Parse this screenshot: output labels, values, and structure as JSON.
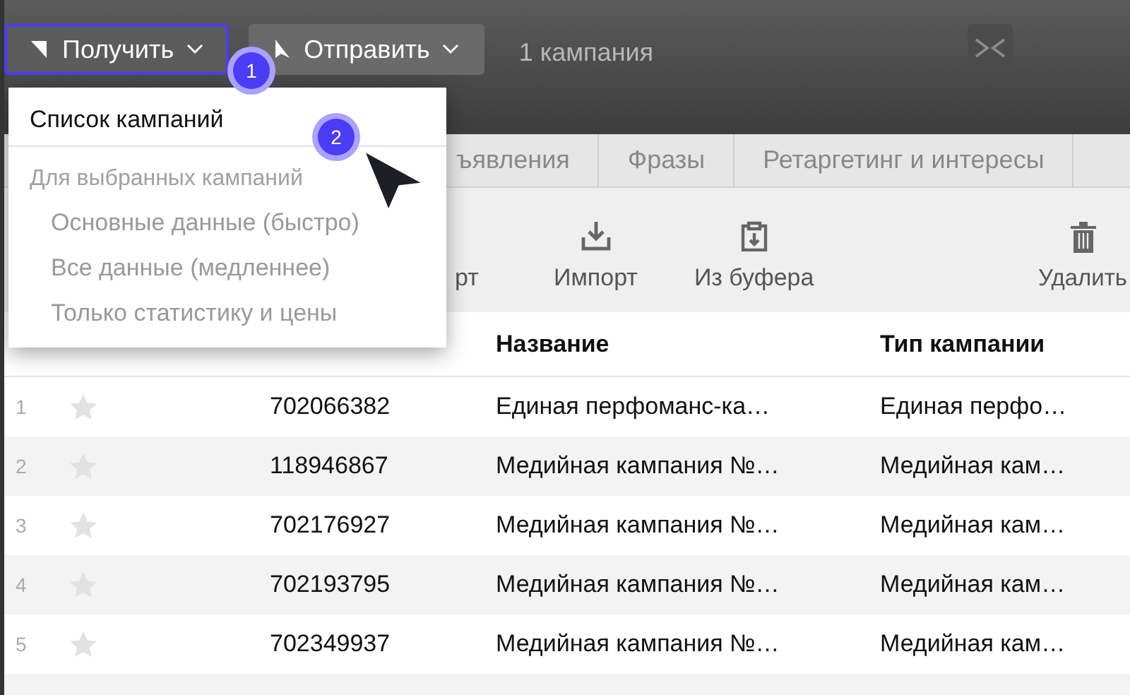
{
  "toolbar_top": {
    "buttons": [
      {
        "label": "Получить",
        "kind": "get",
        "selected": true
      },
      {
        "label": "Отправить",
        "kind": "send",
        "selected": false
      }
    ],
    "summary": "1 кампания"
  },
  "menu": {
    "items": [
      {
        "label": "Список кампаний",
        "kind": "item",
        "disabled": false
      },
      {
        "label": "Для выбранных кампаний",
        "kind": "group"
      },
      {
        "label": "Основные данные (быстро)",
        "kind": "item",
        "disabled": true
      },
      {
        "label": "Все данные (медленнее)",
        "kind": "item",
        "disabled": true
      },
      {
        "label": "Только статистику и цены",
        "kind": "item",
        "disabled": true
      }
    ]
  },
  "badges": [
    "1",
    "2"
  ],
  "tabs": [
    {
      "label": "ъявления",
      "selected": false
    },
    {
      "label": "Фразы",
      "selected": false
    },
    {
      "label": "Ретаргетинг и интересы",
      "selected": false
    }
  ],
  "actions": [
    {
      "label": "рт",
      "kind": "none"
    },
    {
      "label": "Импорт",
      "kind": "import"
    },
    {
      "label": "Из буфера",
      "kind": "clipboard"
    },
    {
      "label": "Удалить",
      "kind": "delete"
    }
  ],
  "table": {
    "columns": [
      "Название",
      "Тип кампании"
    ],
    "rows": [
      {
        "n": "1",
        "starred": false,
        "id": "702066382",
        "name": "Единая перфоманс-ка…",
        "type": "Единая перфо…"
      },
      {
        "n": "2",
        "starred": false,
        "id": "118946867",
        "name": "Медийная кампания №…",
        "type": "Медийная кам…"
      },
      {
        "n": "3",
        "starred": false,
        "id": "702176927",
        "name": "Медийная кампания №…",
        "type": "Медийная кам…"
      },
      {
        "n": "4",
        "starred": false,
        "id": "702193795",
        "name": "Медийная кампания №…",
        "type": "Медийная кам…"
      },
      {
        "n": "5",
        "starred": false,
        "id": "702349937",
        "name": "Медийная кампания №…",
        "type": "Медийная кам…"
      }
    ]
  }
}
